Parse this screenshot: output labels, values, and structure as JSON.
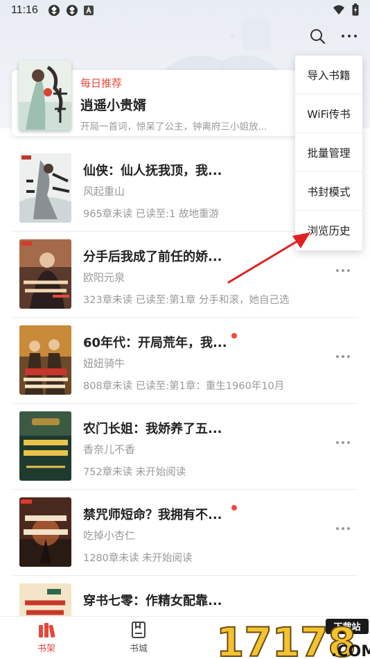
{
  "status_bar": {
    "time": "11:16"
  },
  "toolbar": {
    "search_icon": "search-icon",
    "more_icon": "more-horizontal-icon"
  },
  "recommend": {
    "tag": "每日推荐",
    "title": "逍遥小贵婿",
    "description": "开局一首词，惊呆了公主，钟离府三小姐放..."
  },
  "books": [
    {
      "title": "仙侠：仙人抚我顶，我...",
      "author": "风起重山",
      "progress": "965章未读 已读至:1 故地重游",
      "has_update_dot": false
    },
    {
      "title": "分手后我成了前任的娇...",
      "author": "欧阳元泉",
      "progress": "323章未读 已读至:第1章 分手和滚，她自己选",
      "has_update_dot": false
    },
    {
      "title": "60年代：开局荒年，我...",
      "author": "妞妞骑牛",
      "progress": "808章未读 已读至:第1章：重生1960年10月",
      "has_update_dot": true
    },
    {
      "title": "农门长姐：我娇养了五...",
      "author": "香奈儿不香",
      "progress": "752章未读 未开始阅读",
      "has_update_dot": false
    },
    {
      "title": "禁咒师短命？我拥有不...",
      "author": "吃掉小杏仁",
      "progress": "1280章未读 未开始阅读",
      "has_update_dot": true
    },
    {
      "title": "穿书七零：作精女配靠...",
      "author": "",
      "progress": "",
      "has_update_dot": false
    }
  ],
  "menu": {
    "items": [
      "导入书籍",
      "WiFi传书",
      "批量管理",
      "书封模式",
      "浏览历史"
    ]
  },
  "bottom_nav": {
    "items": [
      {
        "label": "书架",
        "icon": "bookshelf-icon",
        "active": true
      },
      {
        "label": "书城",
        "icon": "bookstore-icon",
        "active": false
      }
    ]
  },
  "watermark": {
    "text": "17178",
    "sub_text": "下载站",
    "domain": ".COM"
  },
  "colors": {
    "accent": "#e5483b",
    "text_primary": "#222222",
    "text_secondary": "#999999",
    "header_bg": "#e8ecf3",
    "annotation_arrow": "#e02020"
  }
}
